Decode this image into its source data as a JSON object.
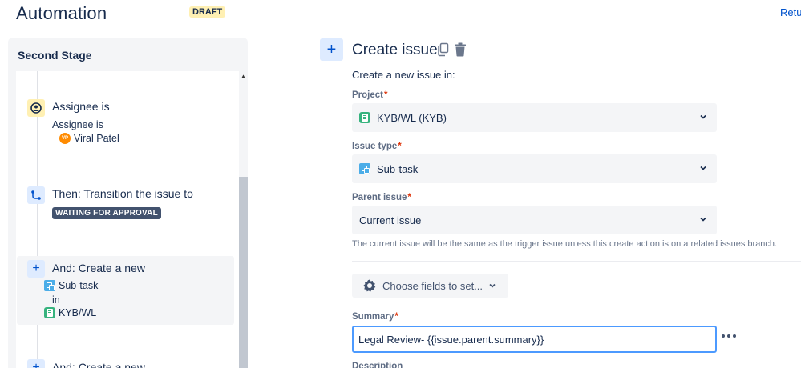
{
  "header": {
    "title": "Automation",
    "status_badge": "DRAFT",
    "return_link": "Retu"
  },
  "stage": {
    "title": "Second Stage",
    "rules": [
      {
        "icon": "user-circle-icon",
        "icon_bg": "#fff0b3",
        "heading": "Assignee is",
        "lines": [
          "Assignee is"
        ],
        "assignee": {
          "initials": "VP",
          "name": "Viral Patel"
        }
      },
      {
        "icon": "transition-icon",
        "icon_bg": "#deebff",
        "heading": "Then: Transition the issue to",
        "status": "WAITING FOR APPROVAL"
      },
      {
        "icon": "plus-icon",
        "icon_bg": "#deebff",
        "heading": "And: Create a new",
        "issue_type": "Sub-task",
        "connector": "in",
        "project": "KYB/WL",
        "selected": true
      },
      {
        "icon": "plus-icon",
        "icon_bg": "#deebff",
        "heading": "And: Create a new"
      }
    ]
  },
  "form": {
    "title": "Create issue",
    "subtitle": "Create a new issue in:",
    "project": {
      "label": "Project",
      "value": "KYB/WL (KYB)"
    },
    "issue_type": {
      "label": "Issue type",
      "value": "Sub-task"
    },
    "parent_issue": {
      "label": "Parent issue",
      "value": "Current issue"
    },
    "help_text": "The current issue will be the same as the trigger issue unless this create action is on a related issues branch.",
    "choose_fields_label": "Choose fields to set...",
    "summary": {
      "label": "Summary",
      "value": "Legal Review- {{issue.parent.summary}}"
    },
    "description_label": "Description",
    "required_mark": "*"
  },
  "colors": {
    "accent": "#0052cc",
    "focus_border": "#4c9aff",
    "lozenge_bg": "#42526e",
    "draft_bg": "#fff0b3"
  }
}
